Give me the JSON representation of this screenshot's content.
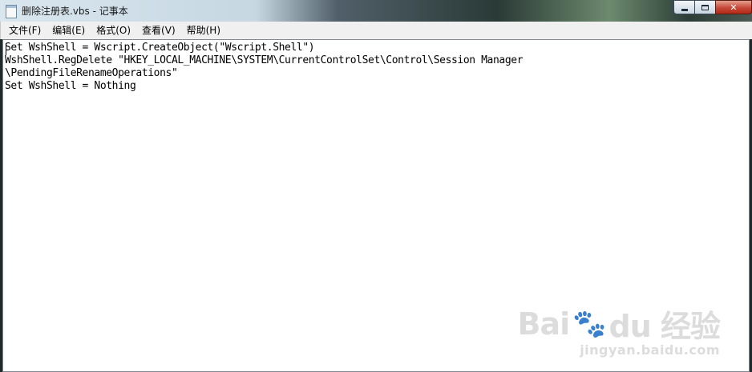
{
  "window": {
    "title": "删除注册表.vbs - 记事本",
    "controls": {
      "close_label": "✕"
    }
  },
  "menu": [
    {
      "label": "文件(F)"
    },
    {
      "label": "编辑(E)"
    },
    {
      "label": "格式(O)"
    },
    {
      "label": "查看(V)"
    },
    {
      "label": "帮助(H)"
    }
  ],
  "editor": {
    "lines": [
      "Set WshShell = Wscript.CreateObject(\"Wscript.Shell\")",
      "WshShell.RegDelete \"HKEY_LOCAL_MACHINE\\SYSTEM\\CurrentControlSet\\Control\\Session Manager",
      "\\PendingFileRenameOperations\"",
      "Set WshShell = Nothing"
    ]
  },
  "watermark": {
    "logo_left": "Bai",
    "logo_right": "du 经验",
    "site": "jingyan.baidu.com"
  }
}
